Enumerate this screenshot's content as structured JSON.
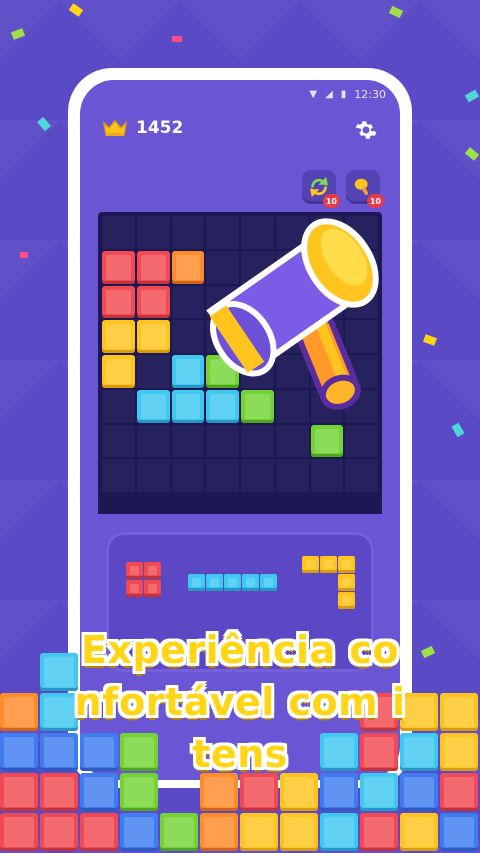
{
  "status_bar": {
    "time": "12:30"
  },
  "header": {
    "score": "1452"
  },
  "powerups": [
    {
      "name": "refresh",
      "count": "10"
    },
    {
      "name": "hammer",
      "count": "10"
    }
  ],
  "headline": {
    "line1": "Experiência co",
    "line2": "nfortável com i",
    "line3": "tens"
  },
  "colors": {
    "background": "#5b4ac6",
    "screen": "#6a55d4",
    "board": "#1c1854",
    "headline_text": "#ffd516",
    "badge": "#e63a4a"
  }
}
